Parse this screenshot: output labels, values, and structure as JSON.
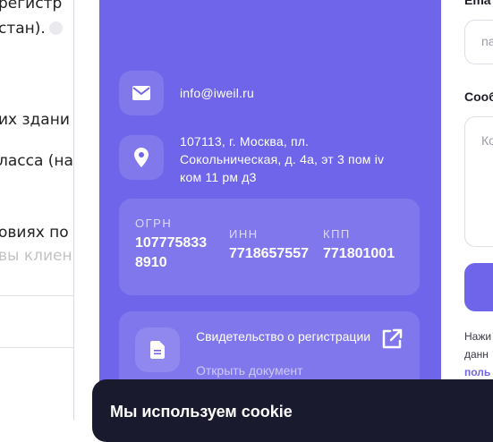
{
  "background_page": {
    "lines": [
      "регистр",
      "стан).",
      "их здани",
      "ласса (на",
      "овиях по",
      "вы клиен"
    ]
  },
  "contacts": {
    "email": "info@iweil.ru",
    "address_lines": [
      "107113, г. Москва, пл.",
      "Сокольническая, д. 4а, эт 3 пом iv",
      "ком 11 рм д3"
    ],
    "ids": {
      "ogrn": {
        "label": "ОГРН",
        "value_lines": [
          "107775833",
          "8910"
        ]
      },
      "inn": {
        "label": "ИНН",
        "value": "7718657557"
      },
      "kpp": {
        "label": "КПП",
        "value": "771801001"
      }
    },
    "certificate": {
      "title": "Свидетельство о регистрации",
      "link": "Открыть документ"
    }
  },
  "form": {
    "email_label": "Ema",
    "name_placeholder": "na",
    "message_label": "Сооб",
    "message_placeholder": "Ко",
    "consent_lines": [
      "Нажи",
      "данн",
      "поль"
    ]
  },
  "cookie_banner": {
    "title": "Мы используем cookie"
  },
  "colors": {
    "panel": "#6f65ea",
    "cookie_bg": "#1a1a2e"
  }
}
